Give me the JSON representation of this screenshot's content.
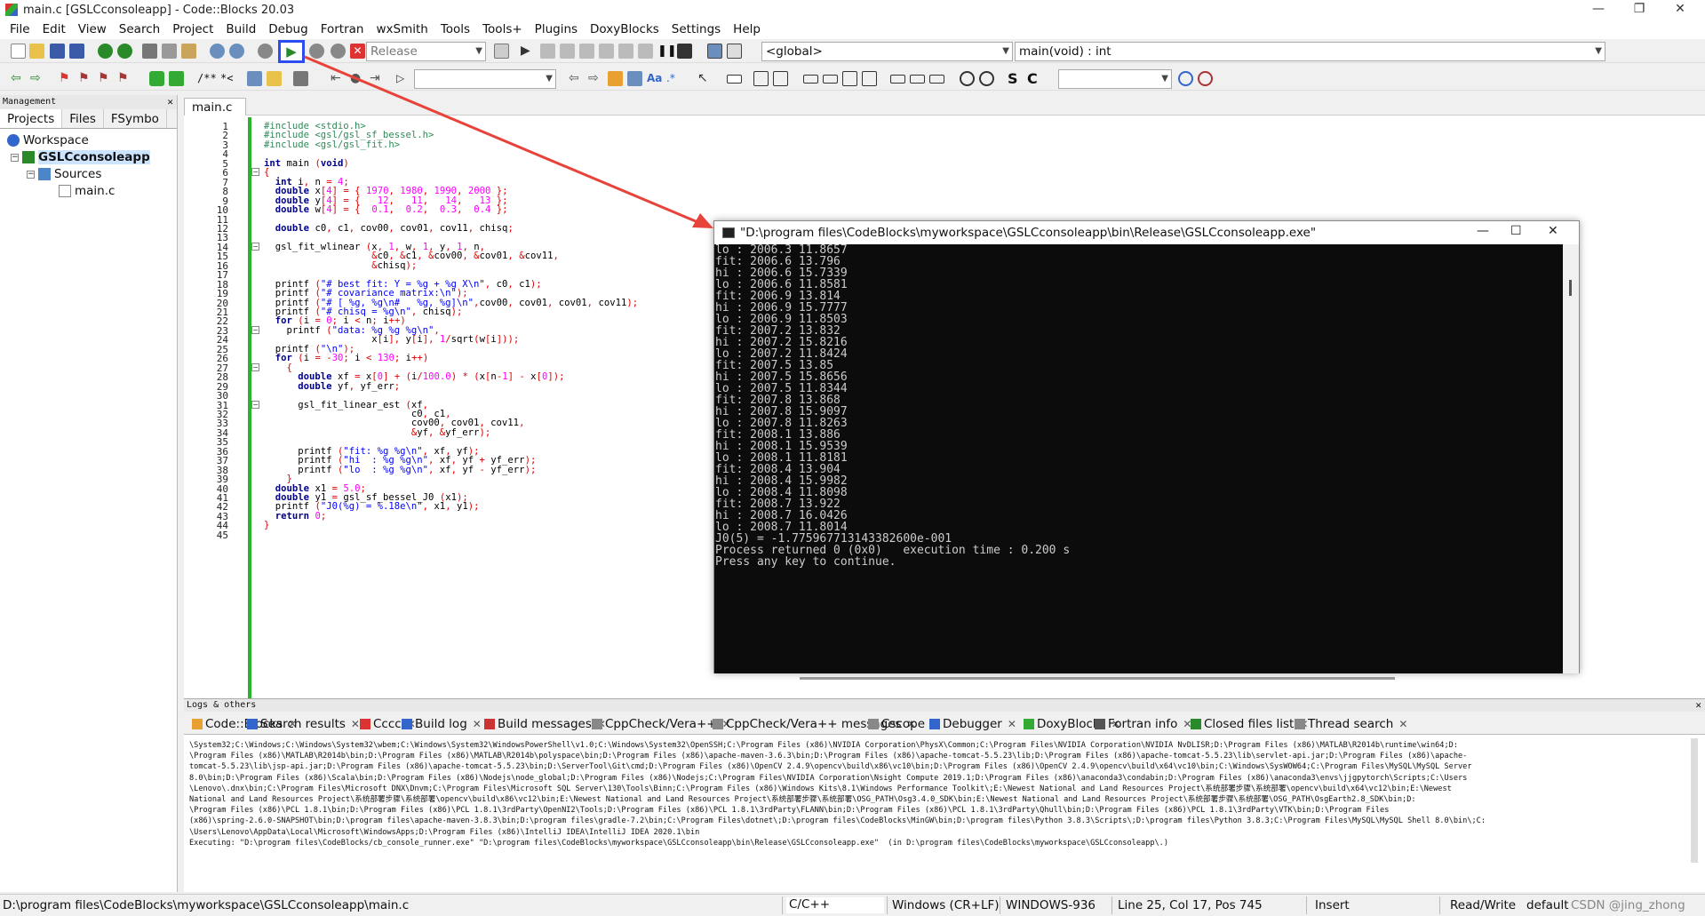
{
  "window": {
    "title": "main.c [GSLCconsoleapp] - Code::Blocks 20.03",
    "minimize": "—",
    "maximize": "❐",
    "close": "✕"
  },
  "menu": [
    "File",
    "Edit",
    "View",
    "Search",
    "Project",
    "Build",
    "Debug",
    "Fortran",
    "wxSmith",
    "Tools",
    "Tools+",
    "Plugins",
    "DoxyBlocks",
    "Settings",
    "Help"
  ],
  "toolbar": {
    "build_target": "Release",
    "scope": "<global>",
    "function": "main(void) : int",
    "search_placeholder": "",
    "symbol_s": "S",
    "symbol_c": "C"
  },
  "management": {
    "title": "Management",
    "close": "✕",
    "tabs": [
      "Projects",
      "Files",
      "FSymbo"
    ],
    "tree": {
      "workspace": "Workspace",
      "project": "GSLCconsoleapp",
      "folder": "Sources",
      "file": "main.c"
    }
  },
  "editor": {
    "tab": "main.c",
    "tab_close": "✕",
    "line_numbers": [
      "1",
      "2",
      "3",
      "4",
      "5",
      "6",
      "7",
      "8",
      "9",
      "10",
      "11",
      "12",
      "13",
      "14",
      "15",
      "16",
      "17",
      "18",
      "19",
      "20",
      "21",
      "22",
      "23",
      "24",
      "25",
      "26",
      "27",
      "28",
      "29",
      "30",
      "31",
      "32",
      "33",
      "34",
      "35",
      "36",
      "37",
      "38",
      "39",
      "40",
      "41",
      "42",
      "43",
      "44",
      "45"
    ],
    "lines": [
      "#include <stdio.h>",
      "#include <gsl/gsl_sf_bessel.h>",
      "#include <gsl/gsl_fit.h>",
      "",
      "int main (void)",
      "{",
      "  int i, n = 4;",
      "  double x[4] = { 1970, 1980, 1990, 2000 };",
      "  double y[4] = {   12,   11,   14,   13 };",
      "  double w[4] = {  0.1,  0.2,  0.3,  0.4 };",
      "",
      "  double c0, c1, cov00, cov01, cov11, chisq;",
      "",
      "  gsl_fit_wlinear (x, 1, w, 1, y, 1, n,",
      "                   &c0, &c1, &cov00, &cov01, &cov11,",
      "                   &chisq);",
      "",
      "  printf (\"# best fit: Y = %g + %g X\\n\", c0, c1);",
      "  printf (\"# covariance matrix:\\n\");",
      "  printf (\"# [ %g, %g\\n#   %g, %g]\\n\",cov00, cov01, cov01, cov11);",
      "  printf (\"# chisq = %g\\n\", chisq);",
      "  for (i = 0; i < n; i++)",
      "    printf (\"data: %g %g %g\\n\",",
      "                   x[i], y[i], 1/sqrt(w[i]));",
      "  printf (\"\\n\");",
      "  for (i = -30; i < 130; i++)",
      "    {",
      "      double xf = x[0] + (i/100.0) * (x[n-1] - x[0]);",
      "      double yf, yf_err;",
      "",
      "      gsl_fit_linear_est (xf,",
      "                          c0, c1,",
      "                          cov00, cov01, cov11,",
      "                          &yf, &yf_err);",
      "",
      "      printf (\"fit: %g %g\\n\", xf, yf);",
      "      printf (\"hi  : %g %g\\n\", xf, yf + yf_err);",
      "      printf (\"lo  : %g %g\\n\", xf, yf - yf_err);",
      "    }",
      "  double x1 = 5.0;",
      "  double y1 = gsl_sf_bessel_J0 (x1);",
      "  printf (\"J0(%g) = %.18e\\n\", x1, y1);",
      "  return 0;",
      "}",
      ""
    ]
  },
  "terminal": {
    "title": "\"D:\\program files\\CodeBlocks\\myworkspace\\GSLCconsoleapp\\bin\\Release\\GSLCconsoleapp.exe\"",
    "minimize": "—",
    "maximize": "☐",
    "close": "✕",
    "output": [
      "lo : 2006.3 11.8657",
      "fit: 2006.6 13.796",
      "hi : 2006.6 15.7339",
      "lo : 2006.6 11.8581",
      "fit: 2006.9 13.814",
      "hi : 2006.9 15.7777",
      "lo : 2006.9 11.8503",
      "fit: 2007.2 13.832",
      "hi : 2007.2 15.8216",
      "lo : 2007.2 11.8424",
      "fit: 2007.5 13.85",
      "hi : 2007.5 15.8656",
      "lo : 2007.5 11.8344",
      "fit: 2007.8 13.868",
      "hi : 2007.8 15.9097",
      "lo : 2007.8 11.8263",
      "fit: 2008.1 13.886",
      "hi : 2008.1 15.9539",
      "lo : 2008.1 11.8181",
      "fit: 2008.4 13.904",
      "hi : 2008.4 15.9982",
      "lo : 2008.4 11.8098",
      "fit: 2008.7 13.922",
      "hi : 2008.7 16.0426",
      "lo : 2008.7 11.8014",
      "J0(5) = -1.775967713143382600e-001",
      "",
      "Process returned 0 (0x0)   execution time : 0.200 s",
      "Press any key to continue."
    ]
  },
  "logs": {
    "title": "Logs & others",
    "close": "✕",
    "tabs": [
      "Code::Blocks",
      "Search results",
      "Cccc",
      "Build log",
      "Build messages",
      "CppCheck/Vera++",
      "CppCheck/Vera++ messages",
      "Cscope",
      "Debugger",
      "DoxyBlocks",
      "Fortran info",
      "Closed files list",
      "Thread search"
    ],
    "tab_close": "✕",
    "text": [
      "\\System32;C:\\Windows;C:\\Windows\\System32\\wbem;C:\\Windows\\System32\\WindowsPowerShell\\v1.0;C:\\Windows\\System32\\OpenSSH;C:\\Program Files (x86)\\NVIDIA Corporation\\PhysX\\Common;C:\\Program Files\\NVIDIA Corporation\\NVIDIA NvDLISR;D:\\Program Files (x86)\\MATLAB\\R2014b\\runtime\\win64;D:",
      "\\Program Files (x86)\\MATLAB\\R2014b\\bin;D:\\Program Files (x86)\\MATLAB\\R2014b\\polyspace\\bin;D:\\Program Files (x86)\\apache-maven-3.6.3\\bin;D:\\Program Files (x86)\\apache-tomcat-5.5.23\\lib;D:\\Program Files (x86)\\apache-tomcat-5.5.23\\lib\\servlet-api.jar;D:\\Program Files (x86)\\apache-",
      "tomcat-5.5.23\\lib\\jsp-api.jar;D:\\Program Files (x86)\\apache-tomcat-5.5.23\\bin;D:\\ServerTool\\Git\\cmd;D:\\Program Files (x86)\\OpenCV 2.4.9\\opencv\\build\\x86\\vc10\\bin;D:\\Program Files (x86)\\OpenCV 2.4.9\\opencv\\build\\x64\\vc10\\bin;C:\\Windows\\SysWOW64;C:\\Program Files\\MySQL\\MySQL Server",
      "8.0\\bin;D:\\Program Files (x86)\\Scala\\bin;D:\\Program Files (x86)\\Nodejs\\node_global;D:\\Program Files (x86)\\Nodejs;C:\\Program Files\\NVIDIA Corporation\\Nsight Compute 2019.1;D:\\Program Files (x86)\\anaconda3\\condabin;D:\\Program Files (x86)\\anaconda3\\envs\\jjgpytorch\\Scripts;C:\\Users",
      "\\Lenovo\\.dnx\\bin;C:\\Program Files\\Microsoft DNX\\Dnvm;C:\\Program Files\\Microsoft SQL Server\\130\\Tools\\Binn;C:\\Program Files (x86)\\Windows Kits\\8.1\\Windows Performance Toolkit\\;E:\\Newest National and Land Resources Project\\系统部署步骤\\系统部署\\opencv\\build\\x64\\vc12\\bin;E:\\Newest",
      "National and Land Resources Project\\系统部署步骤\\系统部署\\opencv\\build\\x86\\vc12\\bin;E:\\Newest National and Land Resources Project\\系统部署步骤\\系统部署\\OSG_PATH\\Osg3.4.0_SDK\\bin;E:\\Newest National and Land Resources Project\\系统部署步骤\\系统部署\\OSG_PATH\\OsgEarth2.8_SDK\\bin;D:",
      "\\Program Files (x86)\\PCL 1.8.1\\bin;D:\\Program Files (x86)\\PCL 1.8.1\\3rdParty\\OpenNI2\\Tools;D:\\Program Files (x86)\\PCL 1.8.1\\3rdParty\\FLANN\\bin;D:\\Program Files (x86)\\PCL 1.8.1\\3rdParty\\Qhull\\bin;D:\\Program Files (x86)\\PCL 1.8.1\\3rdParty\\VTK\\bin;D:\\Program Files",
      "(x86)\\spring-2.6.0-SNAPSHOT\\bin;D:\\program files\\apache-maven-3.8.3\\bin;D:\\program files\\gradle-7.2\\bin;C:\\Program Files\\dotnet\\;D:\\program files\\CodeBlocks\\MinGW\\bin;D:\\program files\\Python 3.8.3\\Scripts\\;D:\\program files\\Python 3.8.3;C:\\Program Files\\MySQL\\MySQL Shell 8.0\\bin\\;C:",
      "\\Users\\Lenovo\\AppData\\Local\\Microsoft\\WindowsApps;D:\\Program Files (x86)\\IntelliJ IDEA\\IntelliJ IDEA 2020.1\\bin",
      "Executing: \"D:\\program files\\CodeBlocks/cb_console_runner.exe\" \"D:\\program files\\CodeBlocks\\myworkspace\\GSLCconsoleapp\\bin\\Release\\GSLCconsoleapp.exe\"  (in D:\\program files\\CodeBlocks\\myworkspace\\GSLCconsoleapp\\.)"
    ]
  },
  "status": {
    "path": "D:\\program files\\CodeBlocks\\myworkspace\\GSLCconsoleapp\\main.c",
    "lang": "C/C++",
    "eol": "Windows (CR+LF)",
    "encoding": "WINDOWS-936",
    "position": "Line 25, Col 17, Pos 745",
    "mode": "Insert",
    "access": "Read/Write",
    "profile": "default",
    "watermark": "CSDN @jing_zhong"
  },
  "colors": {
    "accent_highlight": "#2d4cf0",
    "annotation_arrow": "#e8433a",
    "change_bar": "#2cb32c"
  }
}
